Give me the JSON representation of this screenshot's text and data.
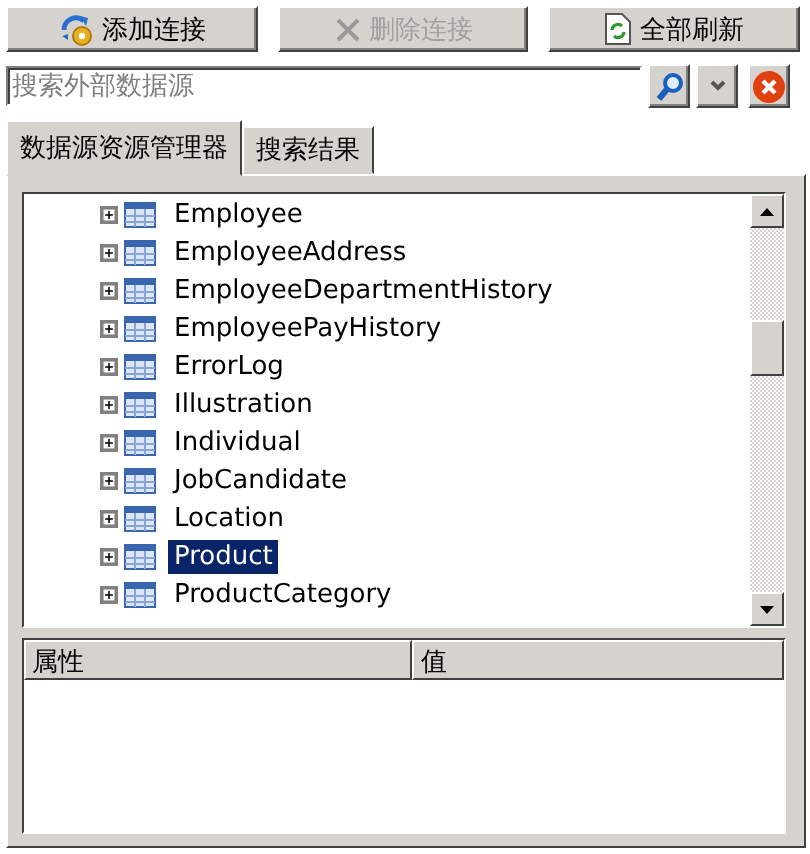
{
  "toolbar": [
    {
      "label": "添加连接",
      "kind": "add-connection",
      "disabled": false
    },
    {
      "label": "删除连接",
      "kind": "delete",
      "disabled": true
    },
    {
      "label": "全部刷新",
      "kind": "refresh",
      "disabled": false
    }
  ],
  "search": {
    "placeholder": "搜索外部数据源"
  },
  "tabs": [
    {
      "label": "数据源资源管理器",
      "selected": true
    },
    {
      "label": "搜索结果",
      "selected": false
    }
  ],
  "tree": {
    "items": [
      {
        "label": "Employee",
        "expanded": false,
        "selected": false
      },
      {
        "label": "EmployeeAddress",
        "expanded": false,
        "selected": false
      },
      {
        "label": "EmployeeDepartmentHistory",
        "expanded": false,
        "selected": false
      },
      {
        "label": "EmployeePayHistory",
        "expanded": false,
        "selected": false
      },
      {
        "label": "ErrorLog",
        "expanded": false,
        "selected": false
      },
      {
        "label": "Illustration",
        "expanded": false,
        "selected": false
      },
      {
        "label": "Individual",
        "expanded": false,
        "selected": false
      },
      {
        "label": "JobCandidate",
        "expanded": false,
        "selected": false
      },
      {
        "label": "Location",
        "expanded": false,
        "selected": false
      },
      {
        "label": "Product",
        "expanded": false,
        "selected": true
      },
      {
        "label": "ProductCategory",
        "expanded": false,
        "selected": false
      }
    ]
  },
  "properties": {
    "columns": [
      "属性",
      "值"
    ]
  }
}
